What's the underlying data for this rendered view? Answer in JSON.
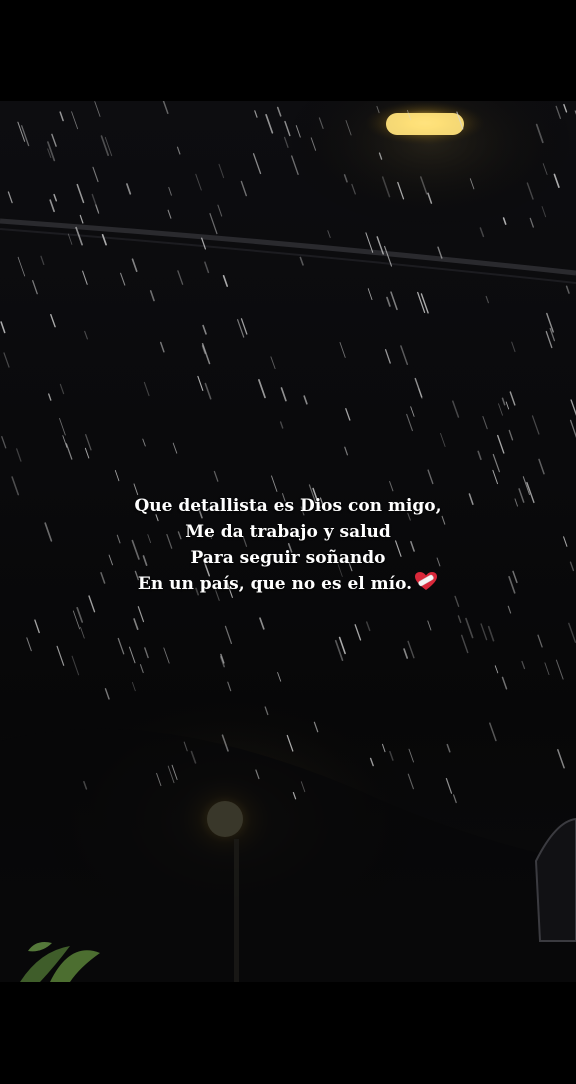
{
  "caption": {
    "lines": [
      "Que detallista es Dios con migo,",
      "Me da trabajo y salud",
      "Para seguir soñando",
      "En un país, que no es el mío."
    ],
    "trailing_icon": "heart-with-bandage-icon"
  },
  "scene": {
    "description_icons": [
      "street-lamp-icon",
      "street-lamp-icon",
      "power-line",
      "rain"
    ],
    "colors": {
      "lamp_glow": "#ffd24a",
      "lamp_core": "#fff6c8",
      "sky": "#0b0b0e",
      "rain": "#d8d8d8"
    }
  }
}
